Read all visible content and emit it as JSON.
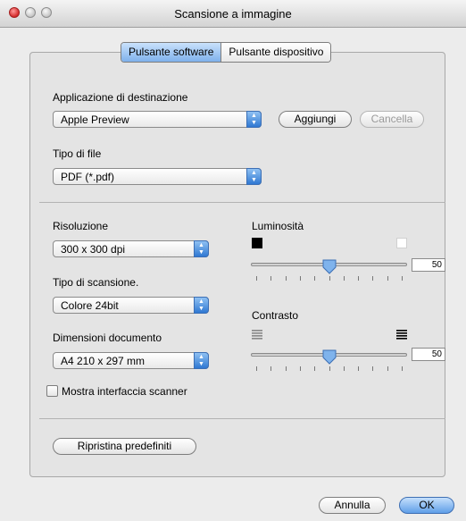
{
  "window": {
    "title": "Scansione a immagine"
  },
  "tabs": [
    {
      "label": "Pulsante software",
      "active": true
    },
    {
      "label": "Pulsante dispositivo",
      "active": false
    }
  ],
  "destination": {
    "label": "Applicazione di destinazione",
    "value": "Apple Preview",
    "add_button": "Aggiungi",
    "delete_button": "Cancella"
  },
  "file_type": {
    "label": "Tipo di file",
    "value": "PDF (*.pdf)"
  },
  "resolution": {
    "label": "Risoluzione",
    "value": "300 x 300 dpi"
  },
  "scan_type": {
    "label": "Tipo di scansione.",
    "value": "Colore 24bit"
  },
  "document_size": {
    "label": "Dimensioni documento",
    "value": "A4  210 x 297 mm"
  },
  "brightness": {
    "label": "Luminosità",
    "value": "50",
    "level": 0.5
  },
  "contrast": {
    "label": "Contrasto",
    "value": "50",
    "level": 0.5
  },
  "show_scanner_interface": {
    "label": "Mostra interfaccia scanner",
    "checked": false
  },
  "restore_defaults_button": "Ripristina predefiniti",
  "footer": {
    "cancel_button": "Annulla",
    "ok_button": "OK"
  },
  "colors": {
    "accent": "#5f9ee8",
    "window_bg": "#ececec"
  }
}
